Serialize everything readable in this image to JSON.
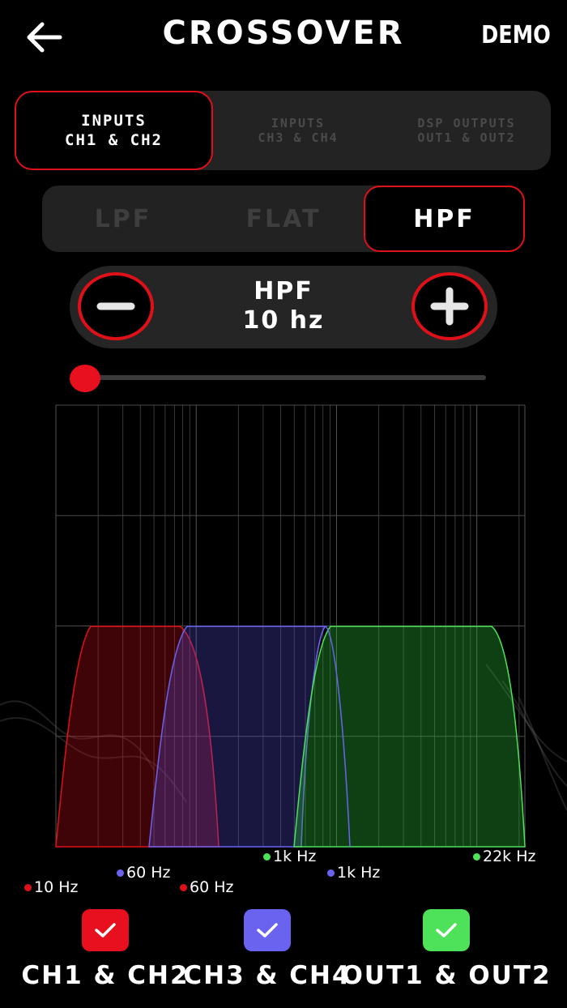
{
  "header": {
    "title": "CROSSOVER",
    "demo_label": "DEMO"
  },
  "channel_tabs": [
    {
      "line1": "INPUTS",
      "line2": "CH1 & CH2",
      "active": true
    },
    {
      "line1": "INPUTS",
      "line2": "CH3 & CH4",
      "active": false
    },
    {
      "line1": "DSP OUTPUTS",
      "line2": "OUT1 & OUT2",
      "active": false
    }
  ],
  "filter_tabs": [
    {
      "label": "LPF",
      "active": false
    },
    {
      "label": "FLAT",
      "active": false
    },
    {
      "label": "HPF",
      "active": true
    }
  ],
  "stepper": {
    "filter": "HPF",
    "value": "10 hz"
  },
  "slider": {
    "value_fraction": 0.0
  },
  "graph_labels": [
    {
      "text": "10 Hz",
      "color": "#e01018"
    },
    {
      "text": "60 Hz",
      "color": "#6a63f0"
    },
    {
      "text": "60 Hz",
      "color": "#e01018"
    },
    {
      "text": "1k Hz",
      "color": "#4ee25a"
    },
    {
      "text": "1k Hz",
      "color": "#6a63f0"
    },
    {
      "text": "22k Hz",
      "color": "#4ee25a"
    }
  ],
  "legend": [
    {
      "label": "CH1 & CH2",
      "color": "#e8101e",
      "checked": true
    },
    {
      "label": "CH3 & CH4",
      "color": "#6a63f0",
      "checked": true
    },
    {
      "label": "OUT1 & OUT2",
      "color": "#4ee25a",
      "checked": true
    }
  ],
  "colors": {
    "accent": "#e01018",
    "ch1": "#e01018",
    "ch3": "#6a63f0",
    "out1": "#4ee25a"
  }
}
